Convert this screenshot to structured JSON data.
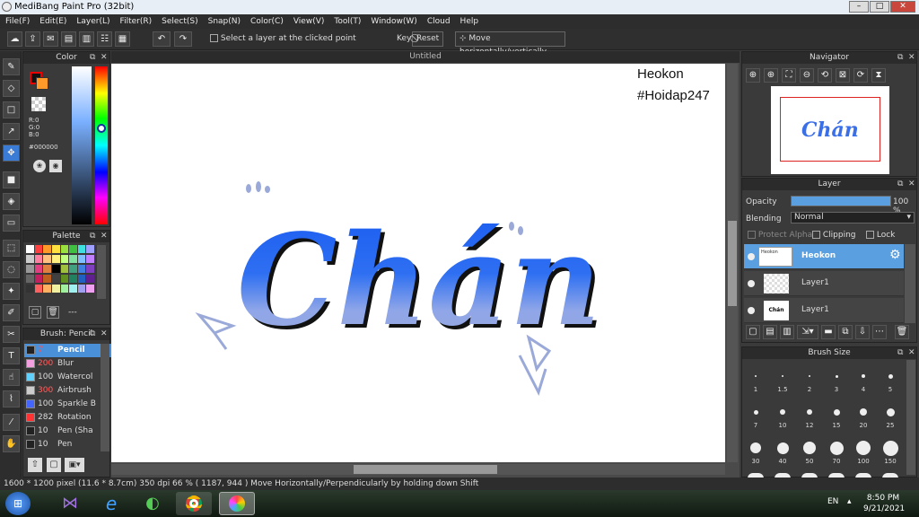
{
  "window": {
    "title": "MediBang Paint Pro (32bit)",
    "min": "–",
    "max": "□",
    "close": "✕"
  },
  "menu": [
    "File(F)",
    "Edit(E)",
    "Layer(L)",
    "Filter(R)",
    "Select(S)",
    "Snap(N)",
    "Color(C)",
    "View(V)",
    "Tool(T)",
    "Window(W)",
    "Cloud",
    "Help"
  ],
  "toolbar": {
    "select_layer_label": "Select a layer at the clicked point",
    "key_label": "Key",
    "reset_label": "Reset",
    "move_label": "Move horizontally/vertically"
  },
  "color_panel": {
    "title": "Color",
    "r": "R:0",
    "g": "G:0",
    "b": "B:0",
    "hex": "#000000"
  },
  "palette_panel": {
    "title": "Palette",
    "dash": "---"
  },
  "brush_panel": {
    "title": "Brush: Pencil",
    "items": [
      {
        "size": "7",
        "name": "Pencil",
        "color": "#222222",
        "size_color": "#ff4444"
      },
      {
        "size": "200",
        "name": "Blur",
        "color": "#f4a0e0",
        "size_color": "#ff4444"
      },
      {
        "size": "100",
        "name": "Watercol",
        "color": "#60d0ff",
        "size_color": "#dddddd"
      },
      {
        "size": "300",
        "name": "Airbrush",
        "color": "#cccccc",
        "size_color": "#ff4444"
      },
      {
        "size": "100",
        "name": "Sparkle B",
        "color": "#4466ff",
        "size_color": "#dddddd"
      },
      {
        "size": "282",
        "name": "Rotation",
        "color": "#ff3333",
        "size_color": "#dddddd"
      },
      {
        "size": "10",
        "name": "Pen (Sha",
        "color": "#222222",
        "size_color": "#dddddd"
      },
      {
        "size": "10",
        "name": "Pen",
        "color": "#222222",
        "size_color": "#dddddd"
      }
    ]
  },
  "document": {
    "tab": "Untitled",
    "watermark_line1": "Heokon",
    "watermark_line2": "#Hoidap247"
  },
  "navigator": {
    "title": "Navigator"
  },
  "layer_panel": {
    "title": "Layer",
    "opacity_label": "Opacity",
    "opacity_value": "100 %",
    "opacity": 1.0,
    "blending_label": "Blending",
    "blending_value": "Normal",
    "protect_alpha": "Protect Alpha",
    "clipping": "Clipping",
    "lock": "Lock",
    "layers": [
      {
        "name": "Heokon",
        "selected": true
      },
      {
        "name": "Layer1",
        "selected": false
      },
      {
        "name": "Layer1",
        "selected": false
      }
    ]
  },
  "brush_size": {
    "title": "Brush Size",
    "labels": [
      "1",
      "1.5",
      "2",
      "3",
      "4",
      "5",
      "7",
      "10",
      "12",
      "15",
      "20",
      "25",
      "30",
      "40",
      "50",
      "70",
      "100",
      "150"
    ]
  },
  "status": "1600 * 1200 pixel  (11.6 * 8.7cm)  350 dpi  66 %  ( 1187, 944 )  Move Horizontally/Perpendicularly by holding down Shift",
  "taskbar": {
    "lang": "EN",
    "time": "8:50 PM",
    "date": "9/21/2021"
  },
  "colors": {
    "accent": "#3a7bd5",
    "selected_layer": "#5aa0e0"
  }
}
